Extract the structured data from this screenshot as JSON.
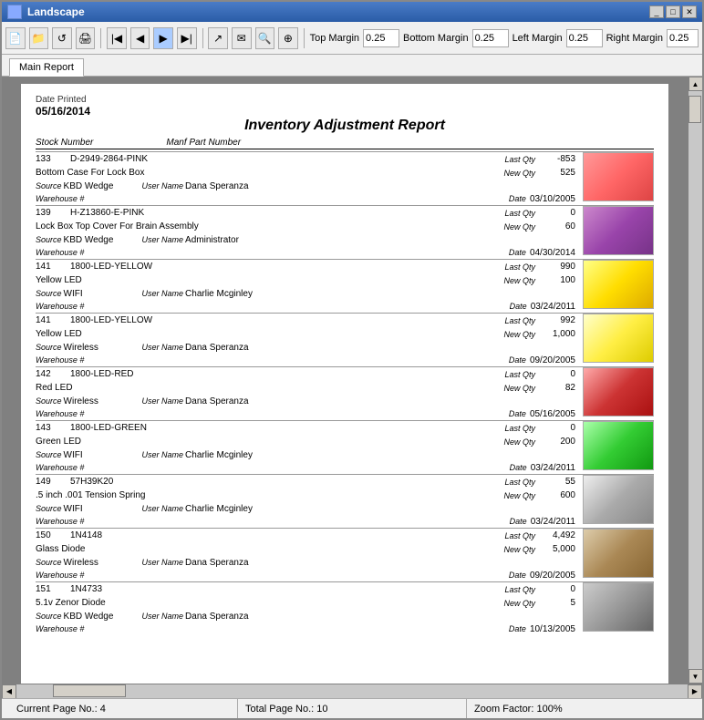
{
  "window": {
    "title": "Landscape"
  },
  "toolbar": {
    "top_margin_label": "Top Margin",
    "top_margin_value": "0.25",
    "bottom_margin_label": "Bottom Margin",
    "bottom_margin_value": "0.25",
    "left_margin_label": "Left Margin",
    "left_margin_value": "0.25",
    "right_margin_label": "Right Margin",
    "right_margin_value": "0.25"
  },
  "tabs": [
    {
      "label": "Main Report",
      "active": true
    }
  ],
  "report": {
    "title": "Inventory Adjustment Report",
    "date_label": "Date Printed",
    "date_value": "05/16/2014",
    "col_left": "Stock Number",
    "col_mid": "Manf Part Number",
    "items": [
      {
        "stock": "133",
        "part": "D-2949-2864-PINK",
        "last_qty_label": "Last Qty",
        "last_qty": "-853",
        "new_qty_label": "New Qty",
        "new_qty": "525",
        "description": "Bottom Case For Lock Box",
        "source_label": "Source",
        "source": "KBD Wedge",
        "user_label": "User Name",
        "user": "Dana Speranza",
        "warehouse_label": "Warehouse #",
        "date_label": "Date",
        "date": "03/10/2005",
        "img_class": "img-pink"
      },
      {
        "stock": "139",
        "part": "H-Z13860-E-PINK",
        "last_qty_label": "Last Qty",
        "last_qty": "0",
        "new_qty_label": "New Qty",
        "new_qty": "60",
        "description": "Lock Box Top Cover For Brain Assembly",
        "source_label": "Source",
        "source": "KBD Wedge",
        "user_label": "User Name",
        "user": "Administrator",
        "warehouse_label": "Warehouse #",
        "date_label": "Date",
        "date": "04/30/2014",
        "img_class": "img-purple"
      },
      {
        "stock": "141",
        "part": "1800-LED-YELLOW",
        "last_qty_label": "Last Qty",
        "last_qty": "990",
        "new_qty_label": "New Qty",
        "new_qty": "100",
        "description": "Yellow LED",
        "source_label": "Source",
        "source": "WIFI",
        "user_label": "User Name",
        "user": "Charlie Mcginley",
        "warehouse_label": "Warehouse #",
        "date_label": "Date",
        "date": "03/24/2011",
        "img_class": "img-yellow"
      },
      {
        "stock": "141",
        "part": "1800-LED-YELLOW",
        "last_qty_label": "Last Qty",
        "last_qty": "992",
        "new_qty_label": "New Qty",
        "new_qty": "1,000",
        "description": "Yellow LED",
        "source_label": "Source",
        "source": "Wireless",
        "user_label": "User Name",
        "user": "Dana Speranza",
        "warehouse_label": "Warehouse #",
        "date_label": "Date",
        "date": "09/20/2005",
        "img_class": "img-yellow2"
      },
      {
        "stock": "142",
        "part": "1800-LED-RED",
        "last_qty_label": "Last Qty",
        "last_qty": "0",
        "new_qty_label": "New Qty",
        "new_qty": "82",
        "description": "Red LED",
        "source_label": "Source",
        "source": "Wireless",
        "user_label": "User Name",
        "user": "Dana Speranza",
        "warehouse_label": "Warehouse #",
        "date_label": "Date",
        "date": "05/16/2005",
        "img_class": "img-red"
      },
      {
        "stock": "143",
        "part": "1800-LED-GREEN",
        "last_qty_label": "Last Qty",
        "last_qty": "0",
        "new_qty_label": "New Qty",
        "new_qty": "200",
        "description": "Green LED",
        "source_label": "Source",
        "source": "WIFI",
        "user_label": "User Name",
        "user": "Charlie Mcginley",
        "warehouse_label": "Warehouse #",
        "date_label": "Date",
        "date": "03/24/2011",
        "img_class": "img-green"
      },
      {
        "stock": "149",
        "part": "57H39K20",
        "last_qty_label": "Last Qty",
        "last_qty": "55",
        "new_qty_label": "New Qty",
        "new_qty": "600",
        "description": ".5 inch .001 Tension Spring",
        "source_label": "Source",
        "source": "WIFI",
        "user_label": "User Name",
        "user": "Charlie Mcginley",
        "warehouse_label": "Warehouse #",
        "date_label": "Date",
        "date": "03/24/2011",
        "img_class": "img-spring"
      },
      {
        "stock": "150",
        "part": "1N4148",
        "last_qty_label": "Last Qty",
        "last_qty": "4,492",
        "new_qty_label": "New Qty",
        "new_qty": "5,000",
        "description": "Glass Diode",
        "source_label": "Source",
        "source": "Wireless",
        "user_label": "User Name",
        "user": "Dana Speranza",
        "warehouse_label": "Warehouse #",
        "date_label": "Date",
        "date": "09/20/2005",
        "img_class": "img-diode"
      },
      {
        "stock": "151",
        "part": "1N4733",
        "last_qty_label": "Last Qty",
        "last_qty": "0",
        "new_qty_label": "New Qty",
        "new_qty": "5",
        "description": "5.1v Zenor Diode",
        "source_label": "Source",
        "source": "KBD Wedge",
        "user_label": "User Name",
        "user": "Dana Speranza",
        "warehouse_label": "Warehouse #",
        "date_label": "Date",
        "date": "10/13/2005",
        "img_class": "img-zenor"
      }
    ]
  },
  "status": {
    "current_page_label": "Current Page No.:",
    "current_page": "4",
    "total_page_label": "Total Page No.:",
    "total_page": "10",
    "zoom_label": "Zoom Factor:",
    "zoom": "100%"
  }
}
